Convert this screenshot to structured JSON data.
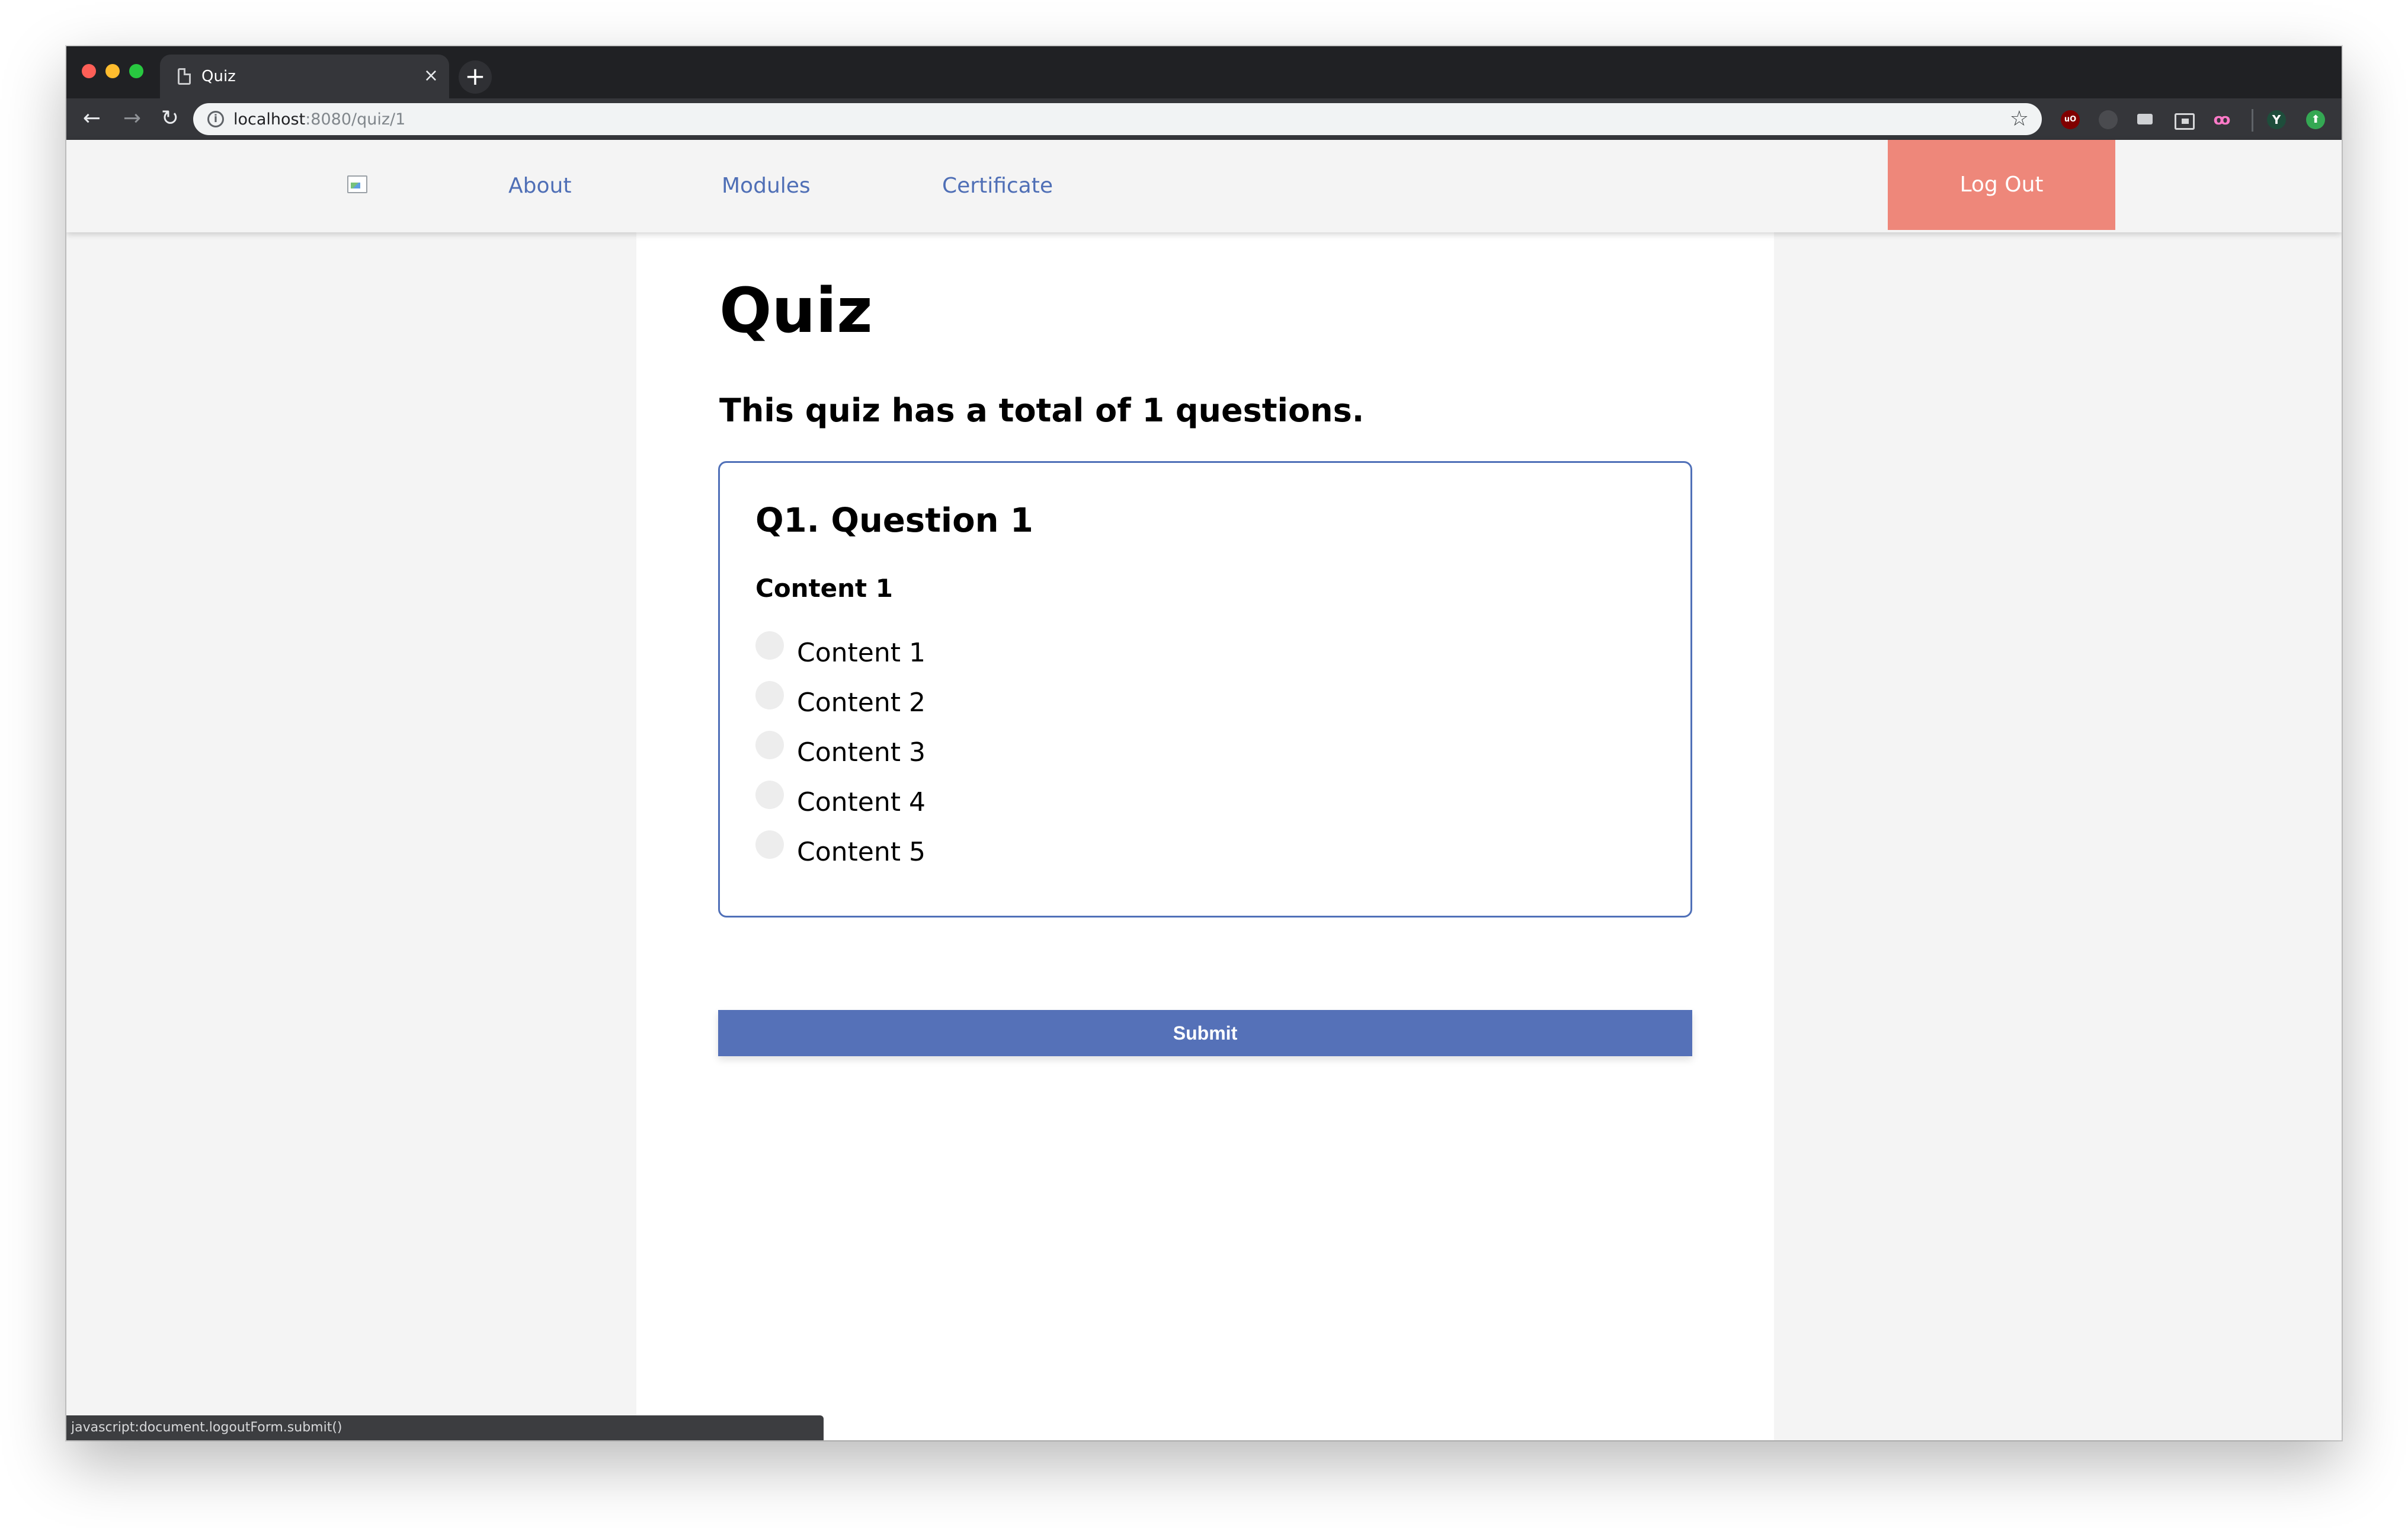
{
  "browser": {
    "tab_title": "Quiz",
    "tab_close": "×",
    "new_tab": "+",
    "url_host": "localhost",
    "url_rest": ":8080/quiz/1",
    "status_text": "javascript:document.logoutForm.submit()",
    "extensions": [
      "ublock-origin-icon",
      "grey-extension-icon",
      "chat-extension-icon",
      "picture-in-picture-icon",
      "owl-extension-icon",
      "profile-avatar-icon",
      "upload-extension-icon"
    ],
    "profile_initial": "Y",
    "ublock_label": "uO"
  },
  "header": {
    "nav": {
      "about": "About",
      "modules": "Modules",
      "certificate": "Certificate"
    },
    "logout_label": "Log Out"
  },
  "main": {
    "title": "Quiz",
    "summary": "This quiz has a total of 1 questions.",
    "questions": [
      {
        "title": "Q1. Question 1",
        "prompt": "Content 1",
        "options": [
          "Content 1",
          "Content 2",
          "Content 3",
          "Content 4",
          "Content 5"
        ]
      }
    ],
    "submit_label": "Submit"
  },
  "colors": {
    "accent": "#5571b8",
    "link": "#4f6fb6",
    "logout": "#ee877a",
    "card_border": "#5070b8"
  }
}
